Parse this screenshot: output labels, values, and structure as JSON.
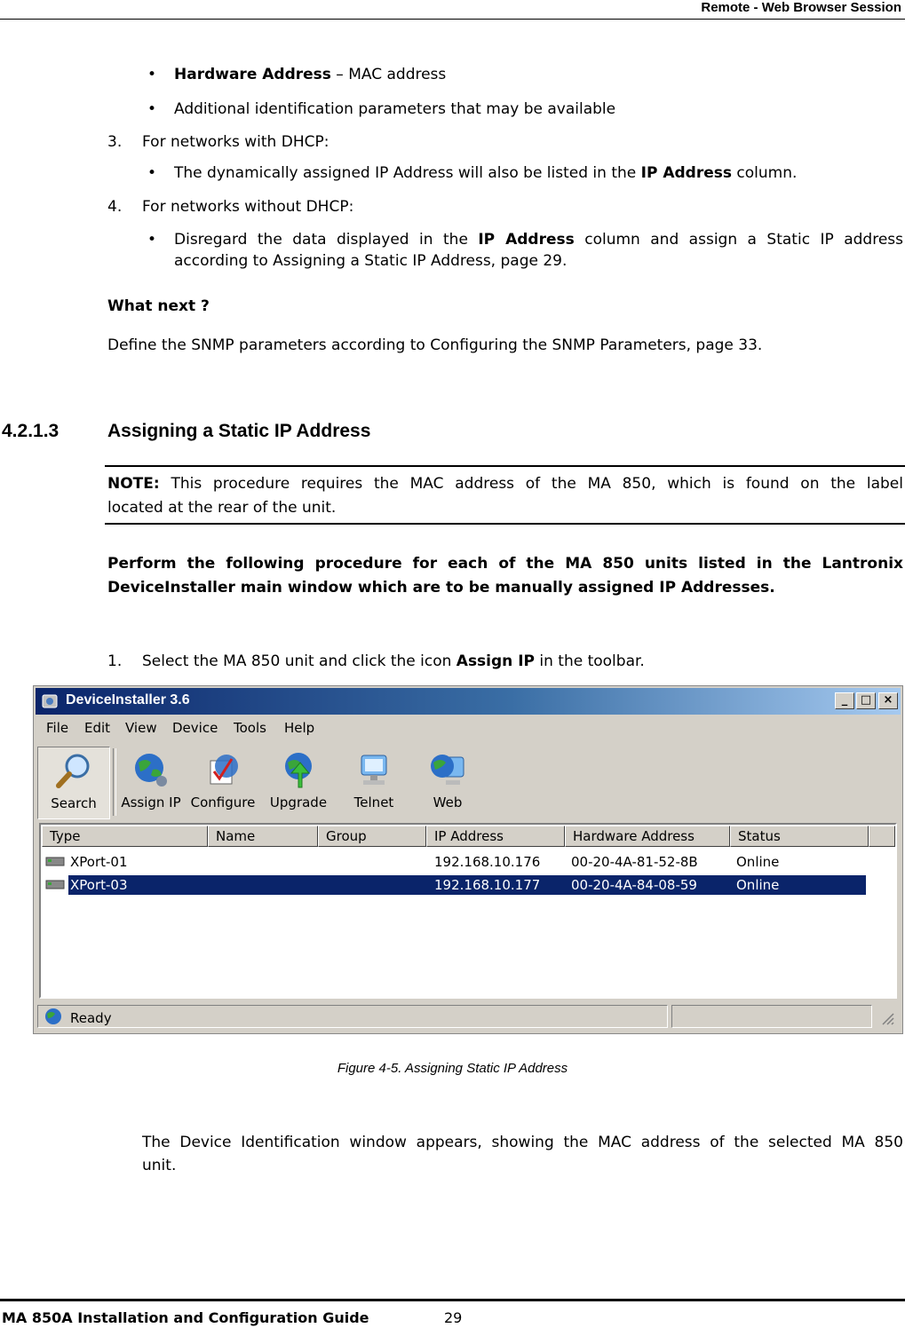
{
  "header": {
    "title": "Remote - Web Browser Session"
  },
  "bullets_top": [
    {
      "bold": "Hardware Address",
      "text": " – MAC address"
    },
    {
      "bold": "",
      "text": "Additional identification parameters that may be available"
    }
  ],
  "step3": {
    "number": "3.",
    "text": "For networks with DHCP:"
  },
  "step3_bullet": {
    "pre": "The dynamically assigned IP Address will also be listed in the ",
    "bold": "IP Address",
    "post": " column."
  },
  "step4": {
    "number": "4.",
    "text": "For networks without DHCP:"
  },
  "step4_bullet": {
    "line1_pre": "Disregard the data displayed in the ",
    "line1_bold": "IP Address",
    "line1_post": " column and assign a Static IP address",
    "line2": "according to Assigning a Static IP Address, page 29."
  },
  "what_next": {
    "heading": "What next ?",
    "text": "Define the SNMP parameters according to Configuring the SNMP Parameters, page 33."
  },
  "section": {
    "number": "4.2.1.3",
    "title": "Assigning a Static IP Address"
  },
  "note": {
    "label": "NOTE:",
    "line1": " This procedure requires the MAC address of the MA 850, which is found on the label",
    "line2": "located at the rear of the unit."
  },
  "instruction": {
    "line1": "Perform the following procedure for each of the MA 850 units listed in the Lantronix",
    "line2": "DeviceInstaller main window which are to be manually assigned IP Addresses."
  },
  "step1": {
    "number": "1.",
    "pre": "Select the MA 850 unit and click the icon ",
    "bold": "Assign IP",
    "post": " in the toolbar."
  },
  "screenshot": {
    "title": "DeviceInstaller 3.6",
    "controls": {
      "minimize": "_",
      "maximize": "□",
      "close": "×"
    },
    "menu": [
      "File",
      "Edit",
      "View",
      "Device",
      "Tools",
      "Help"
    ],
    "toolbar": [
      "Search",
      "Assign IP",
      "Configure",
      "Upgrade",
      "Telnet",
      "Web"
    ],
    "columns": [
      "Type",
      "Name",
      "Group",
      "IP Address",
      "Hardware Address",
      "Status"
    ],
    "rows": [
      {
        "type": "XPort-01",
        "name": "",
        "group": "",
        "ip": "192.168.10.176",
        "mac": "00-20-4A-81-52-8B",
        "status": "Online"
      },
      {
        "type": "XPort-03",
        "name": "",
        "group": "",
        "ip": "192.168.10.177",
        "mac": "00-20-4A-84-08-59",
        "status": "Online"
      }
    ],
    "status": "Ready"
  },
  "caption": "Figure 4-5. Assigning Static IP Address",
  "after_text": {
    "line1": "The Device Identification window appears, showing the MAC address of the selected MA 850",
    "line2": "unit."
  },
  "footer": {
    "title": "MA 850A Installation and Configuration Guide",
    "page": "29"
  }
}
